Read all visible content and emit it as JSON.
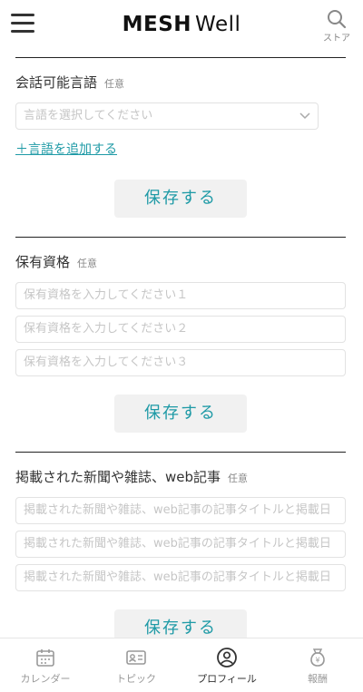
{
  "header": {
    "logo_bold": "MESH",
    "logo_light": "Well",
    "store_label": "ストア"
  },
  "language": {
    "title": "会話可能言語",
    "optional": "任意",
    "select_placeholder": "言語を選択してください",
    "add_link": "＋言語を追加する",
    "save_label": "保存する"
  },
  "qualification": {
    "title": "保有資格",
    "optional": "任意",
    "fields": [
      "保有資格を入力してください１",
      "保有資格を入力してください２",
      "保有資格を入力してください３"
    ],
    "save_label": "保存する"
  },
  "media": {
    "title": "掲載された新聞や雑誌、web記事",
    "optional": "任意",
    "fields": [
      "掲載された新聞や雑誌、web記事の記事タイトルと掲載日",
      "掲載された新聞や雑誌、web記事の記事タイトルと掲載日",
      "掲載された新聞や雑誌、web記事の記事タイトルと掲載日"
    ],
    "save_label": "保存する"
  },
  "tabbar": {
    "tabs": [
      {
        "label": "カレンダー",
        "icon": "calendar-icon"
      },
      {
        "label": "トピック",
        "icon": "id-card-icon"
      },
      {
        "label": "プロフィール",
        "icon": "profile-icon"
      },
      {
        "label": "報酬",
        "icon": "money-bag-icon"
      }
    ],
    "active": "プロフィール"
  },
  "colors": {
    "accent": "#1e9aa6",
    "button_bg": "#f1f1f1",
    "placeholder": "#c6c6c6"
  }
}
